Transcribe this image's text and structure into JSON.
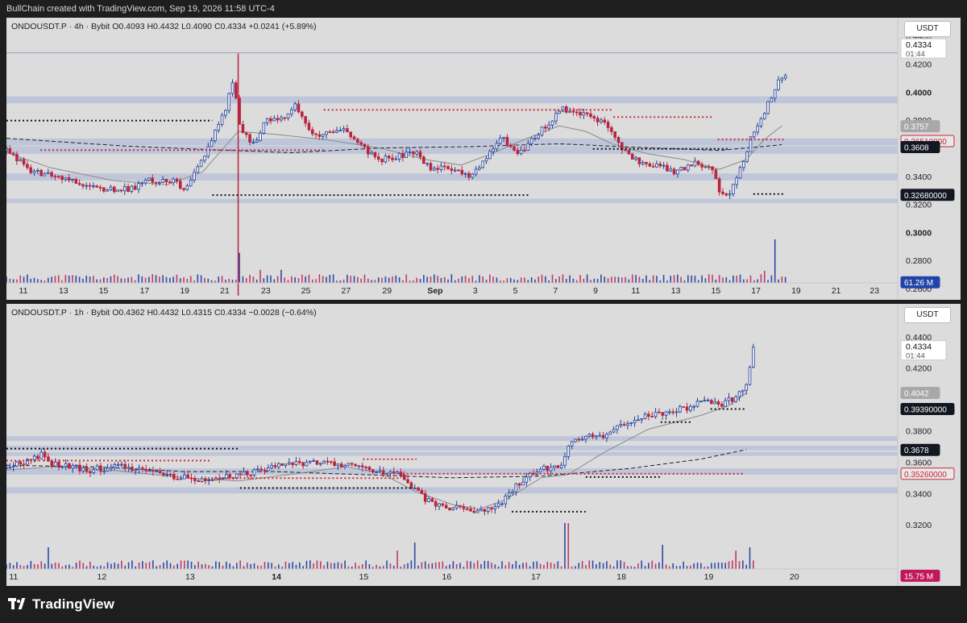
{
  "header": {
    "text": "BullChain created with TradingView.com, Sep 19, 2026 11:58 UTC-4"
  },
  "footer": {
    "brand": "TradingView"
  },
  "panels": [
    {
      "legend": "ONDOUSDT.P · 4h · Bybit  O0.4093  H0.4432  L0.4090  C0.4334  +0.0241 (+5.89%)",
      "currency": "USDT",
      "ylim": [
        0.252,
        0.453
      ],
      "ticks": [
        {
          "v": 0.44,
          "t": "0.4400",
          "bold": false
        },
        {
          "v": 0.42,
          "t": "0.4200",
          "bold": false
        },
        {
          "v": 0.4,
          "t": "0.4000",
          "bold": true
        },
        {
          "v": 0.38,
          "t": "0.3800",
          "bold": false
        },
        {
          "v": 0.34,
          "t": "0.3400",
          "bold": false
        },
        {
          "v": 0.32,
          "t": "0.3200",
          "bold": false
        },
        {
          "v": 0.3,
          "t": "0.3000",
          "bold": true
        },
        {
          "v": 0.28,
          "t": "0.2800",
          "bold": false
        },
        {
          "v": 0.26,
          "t": "0.2600",
          "bold": false
        }
      ],
      "price_label": {
        "v": 0.4334,
        "t1": "0.4334",
        "t2": "01:44"
      },
      "tags": [
        {
          "v": 0.3757,
          "t": "0.3757",
          "bg": "#a8a8a8",
          "fg": "#ffffff"
        },
        {
          "v": 0.3651,
          "t": "0.36510000",
          "bg": "#e8e8e8",
          "fg": "#c62839",
          "border": "#c62839"
        },
        {
          "v": 0.3608,
          "t": "0.3608",
          "bg": "#131722",
          "fg": "#ffffff"
        },
        {
          "v": 0.3268,
          "t": "0.32680000",
          "bg": "#131722",
          "fg": "#ffffff"
        },
        {
          "v": 0.2645,
          "t": "61.26 M",
          "bg": "#2144a8",
          "fg": "#ffffff"
        }
      ],
      "xlabels": [
        {
          "x": 0.019,
          "t": "11",
          "bold": false
        },
        {
          "x": 0.064,
          "t": "13",
          "bold": false
        },
        {
          "x": 0.109,
          "t": "15",
          "bold": false
        },
        {
          "x": 0.155,
          "t": "17",
          "bold": false
        },
        {
          "x": 0.2,
          "t": "19",
          "bold": false
        },
        {
          "x": 0.245,
          "t": "21",
          "bold": false
        },
        {
          "x": 0.291,
          "t": "23",
          "bold": false
        },
        {
          "x": 0.336,
          "t": "25",
          "bold": false
        },
        {
          "x": 0.381,
          "t": "27",
          "bold": false
        },
        {
          "x": 0.427,
          "t": "29",
          "bold": false
        },
        {
          "x": 0.481,
          "t": "Sep",
          "bold": true
        },
        {
          "x": 0.526,
          "t": "3",
          "bold": false
        },
        {
          "x": 0.571,
          "t": "5",
          "bold": false
        },
        {
          "x": 0.616,
          "t": "7",
          "bold": false
        },
        {
          "x": 0.661,
          "t": "9",
          "bold": false
        },
        {
          "x": 0.706,
          "t": "11",
          "bold": false
        },
        {
          "x": 0.751,
          "t": "13",
          "bold": false
        },
        {
          "x": 0.796,
          "t": "15",
          "bold": false
        },
        {
          "x": 0.841,
          "t": "17",
          "bold": false
        },
        {
          "x": 0.886,
          "t": "19",
          "bold": false
        },
        {
          "x": 0.931,
          "t": "21",
          "bold": false
        },
        {
          "x": 0.974,
          "t": "23",
          "bold": false
        }
      ],
      "zones": [
        [
          0.397,
          0.392
        ],
        [
          0.367,
          0.362
        ],
        [
          0.3615,
          0.356
        ],
        [
          0.342,
          0.337
        ],
        [
          0.324,
          0.321
        ]
      ],
      "hline": 0.428,
      "levels": [
        {
          "x1": 0.0,
          "x2": 0.231,
          "v": 0.3797,
          "c": "#111",
          "dash": "2,3"
        },
        {
          "x1": 0.231,
          "x2": 0.587,
          "v": 0.3266,
          "c": "#111",
          "dash": "2,3"
        },
        {
          "x1": 0.038,
          "x2": 0.356,
          "v": 0.3587,
          "c": "#d02a3a",
          "dash": "2,3"
        },
        {
          "x1": 0.356,
          "x2": 0.681,
          "v": 0.3874,
          "c": "#d02a3a",
          "dash": "2,3"
        },
        {
          "x1": 0.681,
          "x2": 0.794,
          "v": 0.3822,
          "c": "#d02a3a",
          "dash": "2,3"
        },
        {
          "x1": 0.798,
          "x2": 0.872,
          "v": 0.3662,
          "c": "#d02a3a",
          "dash": "2,3"
        },
        {
          "x1": 0.838,
          "x2": 0.874,
          "v": 0.3274,
          "c": "#111",
          "dash": "2,3"
        },
        {
          "x1": 0.658,
          "x2": 0.81,
          "v": 0.3595,
          "c": "#111",
          "dash": "2,3"
        }
      ],
      "ma_long": [
        [
          0.0,
          0.3671
        ],
        [
          0.13,
          0.3617
        ],
        [
          0.22,
          0.3592
        ],
        [
          0.32,
          0.3568
        ],
        [
          0.42,
          0.3602
        ],
        [
          0.52,
          0.3612
        ],
        [
          0.62,
          0.3632
        ],
        [
          0.72,
          0.3603
        ],
        [
          0.8,
          0.3585
        ],
        [
          0.87,
          0.3625
        ]
      ],
      "ma_short": [
        [
          0.0,
          0.357
        ],
        [
          0.05,
          0.346
        ],
        [
          0.12,
          0.337
        ],
        [
          0.18,
          0.334
        ],
        [
          0.22,
          0.343
        ],
        [
          0.26,
          0.372
        ],
        [
          0.3,
          0.37
        ],
        [
          0.36,
          0.366
        ],
        [
          0.42,
          0.36
        ],
        [
          0.47,
          0.352
        ],
        [
          0.51,
          0.348
        ],
        [
          0.54,
          0.355
        ],
        [
          0.58,
          0.366
        ],
        [
          0.62,
          0.376
        ],
        [
          0.65,
          0.372
        ],
        [
          0.68,
          0.363
        ],
        [
          0.72,
          0.356
        ],
        [
          0.76,
          0.352
        ],
        [
          0.8,
          0.345
        ],
        [
          0.83,
          0.352
        ],
        [
          0.85,
          0.366
        ],
        [
          0.87,
          0.376
        ]
      ],
      "spike": {
        "x": 0.26,
        "low": 0.255,
        "high": 0.4275
      }
    },
    {
      "legend": "ONDOUSDT.P · 1h · Bybit  O0.4362  H0.4432  L0.4315  C0.4334  −0.0028 (−0.64%)",
      "currency": "USDT",
      "ylim": [
        0.281,
        0.461
      ],
      "ticks": [
        {
          "v": 0.44,
          "t": "0.4400",
          "bold": false
        },
        {
          "v": 0.42,
          "t": "0.4200",
          "bold": false
        },
        {
          "v": 0.38,
          "t": "0.3800",
          "bold": false
        },
        {
          "v": 0.36,
          "t": "0.3600",
          "bold": false
        },
        {
          "v": 0.34,
          "t": "0.3400",
          "bold": false
        },
        {
          "v": 0.32,
          "t": "0.3200",
          "bold": false
        }
      ],
      "price_label": {
        "v": 0.4334,
        "t1": "0.4334",
        "t2": "01:44"
      },
      "tags": [
        {
          "v": 0.4042,
          "t": "0.4042",
          "bg": "#a8a8a8",
          "fg": "#ffffff"
        },
        {
          "v": 0.3939,
          "t": "0.39390000",
          "bg": "#131722",
          "fg": "#ffffff"
        },
        {
          "v": 0.3678,
          "t": "0.3678",
          "bg": "#131722",
          "fg": "#ffffff"
        },
        {
          "v": 0.3526,
          "t": "0.35260000",
          "bg": "#e8e8e8",
          "fg": "#c62839",
          "border": "#c62839"
        },
        {
          "v": 0.2875,
          "t": "15.75 M",
          "bg": "#c2185b",
          "fg": "#ffffff"
        }
      ],
      "xlabels": [
        {
          "x": 0.008,
          "t": "11",
          "bold": false
        },
        {
          "x": 0.107,
          "t": "12",
          "bold": false
        },
        {
          "x": 0.206,
          "t": "13",
          "bold": false
        },
        {
          "x": 0.303,
          "t": "14",
          "bold": true
        },
        {
          "x": 0.401,
          "t": "15",
          "bold": false
        },
        {
          "x": 0.494,
          "t": "16",
          "bold": false
        },
        {
          "x": 0.594,
          "t": "17",
          "bold": false
        },
        {
          "x": 0.69,
          "t": "18",
          "bold": false
        },
        {
          "x": 0.788,
          "t": "19",
          "bold": false
        },
        {
          "x": 0.884,
          "t": "20",
          "bold": false
        }
      ],
      "zones": [
        [
          0.3765,
          0.3735
        ],
        [
          0.3705,
          0.3675
        ],
        [
          0.3665,
          0.364
        ],
        [
          0.356,
          0.352
        ],
        [
          0.344,
          0.34
        ]
      ],
      "levels": [
        {
          "x1": 0.0,
          "x2": 0.262,
          "v": 0.3686,
          "c": "#111",
          "dash": "2,3"
        },
        {
          "x1": 0.0,
          "x2": 0.23,
          "v": 0.361,
          "c": "#d02a3a",
          "dash": "2,3"
        },
        {
          "x1": 0.4,
          "x2": 0.46,
          "v": 0.3619,
          "c": "#d02a3a",
          "dash": "2,3"
        },
        {
          "x1": 0.23,
          "x2": 0.44,
          "v": 0.3498,
          "c": "#d02a3a",
          "dash": "2,3"
        },
        {
          "x1": 0.262,
          "x2": 0.454,
          "v": 0.3435,
          "c": "#111",
          "dash": "2,3"
        },
        {
          "x1": 0.567,
          "x2": 0.65,
          "v": 0.3284,
          "c": "#111",
          "dash": "2,3"
        },
        {
          "x1": 0.65,
          "x2": 0.734,
          "v": 0.3505,
          "c": "#111",
          "dash": "2,3"
        },
        {
          "x1": 0.734,
          "x2": 0.77,
          "v": 0.3855,
          "c": "#111",
          "dash": "2,3"
        },
        {
          "x1": 0.79,
          "x2": 0.828,
          "v": 0.3939,
          "c": "#111",
          "dash": "2,3"
        },
        {
          "x1": 0.44,
          "x2": 0.828,
          "v": 0.3526,
          "c": "#d02a3a",
          "dash": "2,3"
        }
      ],
      "ma_long": [
        [
          0.0,
          0.358
        ],
        [
          0.1,
          0.357
        ],
        [
          0.2,
          0.354
        ],
        [
          0.3,
          0.354
        ],
        [
          0.4,
          0.352
        ],
        [
          0.5,
          0.35
        ],
        [
          0.6,
          0.351
        ],
        [
          0.7,
          0.356
        ],
        [
          0.78,
          0.362
        ],
        [
          0.83,
          0.368
        ]
      ],
      "ma_short": [
        [
          0.0,
          0.355
        ],
        [
          0.05,
          0.357
        ],
        [
          0.1,
          0.356
        ],
        [
          0.2,
          0.35
        ],
        [
          0.26,
          0.348
        ],
        [
          0.33,
          0.353
        ],
        [
          0.38,
          0.357
        ],
        [
          0.42,
          0.353
        ],
        [
          0.46,
          0.341
        ],
        [
          0.5,
          0.333
        ],
        [
          0.53,
          0.33
        ],
        [
          0.56,
          0.336
        ],
        [
          0.6,
          0.35
        ],
        [
          0.63,
          0.352
        ],
        [
          0.67,
          0.366
        ],
        [
          0.72,
          0.381
        ],
        [
          0.78,
          0.39
        ],
        [
          0.81,
          0.396
        ],
        [
          0.83,
          0.404
        ]
      ]
    }
  ]
}
